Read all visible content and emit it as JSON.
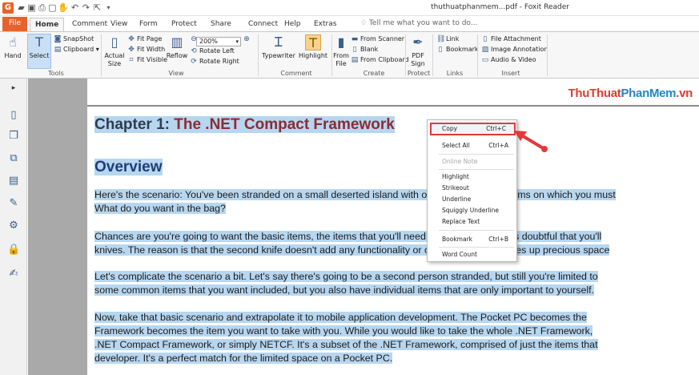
{
  "window": {
    "title": "thuthuatphanmem...pdf - Foxit Reader",
    "logo": "G",
    "quick_access": [
      "folder-open-icon",
      "save-icon",
      "print-icon",
      "page-icon",
      "hand-icon",
      "undo-icon",
      "redo-icon",
      "cursor-icon",
      "customize-icon"
    ]
  },
  "tabs": [
    {
      "label": "File"
    },
    {
      "label": "Home"
    },
    {
      "label": "Comment"
    },
    {
      "label": "View"
    },
    {
      "label": "Form"
    },
    {
      "label": "Protect"
    },
    {
      "label": "Share"
    },
    {
      "label": "Connect"
    },
    {
      "label": "Help"
    },
    {
      "label": "Extras"
    }
  ],
  "tell_me": "Tell me what you want to do...",
  "ribbon": {
    "tools": {
      "hand": "Hand",
      "select": "Select",
      "snapshot": "SnapShot",
      "clipboard": "Clipboard",
      "group": "Tools"
    },
    "view": {
      "actual_size_1": "Actual",
      "actual_size_2": "Size",
      "fit_page": "Fit Page",
      "fit_width": "Fit Width",
      "fit_visible": "Fit Visible",
      "reflow": "Reflow",
      "zoom": "200%",
      "rotate_left": "Rotate Left",
      "rotate_right": "Rotate Right",
      "group": "View"
    },
    "comment": {
      "typewriter": "Typewriter",
      "highlight": "Highlight",
      "group": "Comment"
    },
    "create": {
      "from_file_1": "From",
      "from_file_2": "File",
      "from_scanner": "From Scanner",
      "blank": "Blank",
      "from_clipboard": "From Clipboard",
      "group": "Create"
    },
    "protect": {
      "pdf_sign_1": "PDF",
      "pdf_sign_2": "Sign",
      "group": "Protect"
    },
    "links": {
      "link": "Link",
      "bookmark": "Bookmark",
      "group": "Links"
    },
    "insert": {
      "file_attachment": "File Attachment",
      "image_annotation": "Image Annotation",
      "audio_video": "Audio & Video",
      "group": "Insert"
    }
  },
  "document": {
    "watermark": {
      "part1": "ThuThuat",
      "part2": "PhanMem",
      "part3": ".vn"
    },
    "chapter_prefix": "Chapter 1: ",
    "chapter_title": "The .NET Compact Framework",
    "heading": "Overview",
    "paragraphs": [
      [
        "Here's the scenario: You've been stranded on a small deserted island with only a small bag of items on which you must",
        "What do you want in the bag?"
      ],
      [
        "Chances are you're going to want the basic items, the items that you'll need to have to get by. It's doubtful that you'll",
        "knives. The reason is that the second knife doesn't add any functionality or capabilities, yet it takes up precious space"
      ],
      [
        "Let's complicate the scenario a bit. Let's say there's going to be a second person stranded, but still you're limited to",
        "some common items that you want included, but you also have individual items that are only important to yourself."
      ],
      [
        "Now, take that basic scenario and extrapolate it to mobile application development. The Pocket PC becomes the",
        "Framework becomes the item you want to take with you. While you would like to take the whole .NET Framework,",
        ".NET Compact Framework, or simply NETCF. It's a subset of the .NET Framework, comprised of just the items that",
        "developer. It's a perfect match for the limited space on a Pocket PC."
      ]
    ]
  },
  "context_menu": {
    "copy": {
      "label": "Copy",
      "shortcut": "Ctrl+C"
    },
    "select_all": {
      "label": "Select All",
      "shortcut": "Ctrl+A"
    },
    "online_note": {
      "label": "Online Note"
    },
    "highlight": {
      "label": "Highlight"
    },
    "strikeout": {
      "label": "Strikeout"
    },
    "underline": {
      "label": "Underline"
    },
    "squiggly": {
      "label": "Squiggly Underline"
    },
    "replace": {
      "label": "Replace Text"
    },
    "bookmark": {
      "label": "Bookmark",
      "shortcut": "Ctrl+B"
    },
    "word_count": {
      "label": "Word Count"
    }
  },
  "colors": {
    "accent": "#e8632b",
    "selection": "#b7d6f0",
    "annotation": "#e03a3a"
  }
}
